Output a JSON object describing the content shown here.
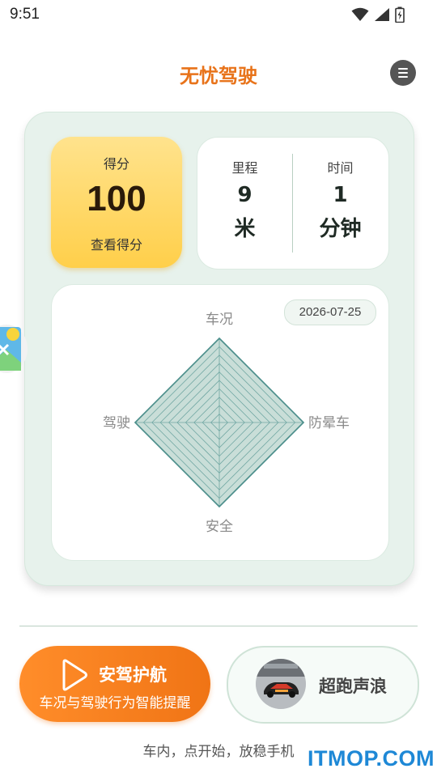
{
  "status_bar": {
    "time": "9:51",
    "icons": [
      "wifi-icon",
      "signal-icon",
      "battery-icon"
    ]
  },
  "header": {
    "title": "无忧驾驶",
    "menu_icon": "menu-icon"
  },
  "score": {
    "label": "得分",
    "value": "100",
    "link": "查看得分"
  },
  "stats": {
    "mileage": {
      "label": "里程",
      "value": "9",
      "unit": "米"
    },
    "time": {
      "label": "时间",
      "value": "1",
      "unit": "分钟"
    }
  },
  "radar": {
    "date": "2026-07-25",
    "axes": [
      "车况",
      "防晕车",
      "安全",
      "驾驶"
    ],
    "values": [
      1,
      1,
      1,
      1
    ],
    "rings": 10,
    "colors": {
      "fill": "#d8e8e2",
      "stroke": "#4d8f8c",
      "grid": "#6fa7a4"
    }
  },
  "actions": {
    "navigate": {
      "title": "安驾护航",
      "subtitle": "车况与驾驶行为智能提醒",
      "icon": "play-icon"
    },
    "sound": {
      "label": "超跑声浪"
    }
  },
  "footer": {
    "hint": "车内，点开始，放稳手机"
  },
  "watermark": "ITMOP.COM",
  "colors": {
    "accent": "#e8731a",
    "card_bg": "#e7f2ec",
    "score_bg": "#ffd75c",
    "nav_button": "#f5801e",
    "watermark": "#1e88d6"
  }
}
